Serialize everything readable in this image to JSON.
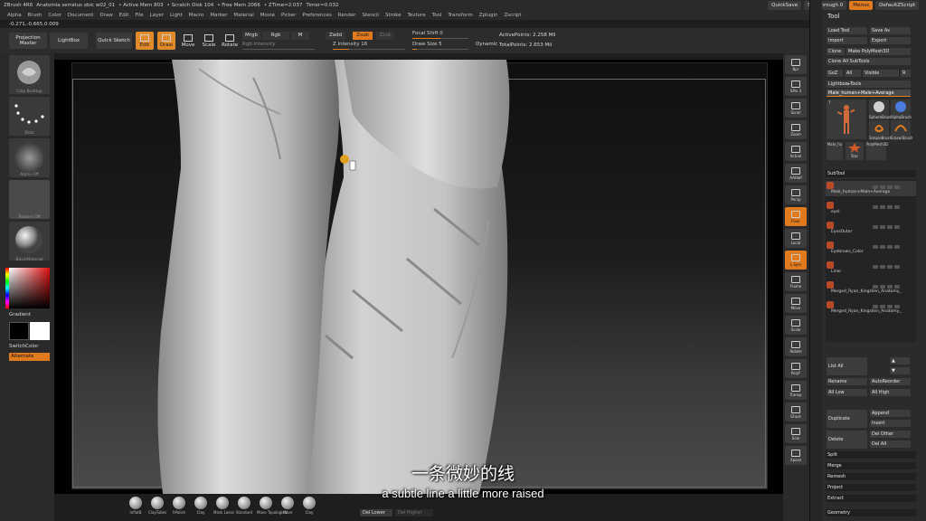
{
  "title_bar": {
    "items": [
      "ZBrush 4R6",
      "Anatomia serratus obic w02_01",
      "• Active Mem 803",
      "• Scratch Disk 104",
      "• Free Mem 2066",
      "• ZTime≈2.037",
      "Timer≈0.032"
    ],
    "right_buttons": [
      "QuickSave",
      "See-through 0",
      "Menus",
      "DefaultZScript"
    ]
  },
  "menu_bar": [
    "Alpha",
    "Brush",
    "Color",
    "Document",
    "Draw",
    "Edit",
    "File",
    "Layer",
    "Light",
    "Macro",
    "Marker",
    "Material",
    "Movie",
    "Picker",
    "Preferences",
    "Render",
    "Stencil",
    "Stroke",
    "Texture",
    "Tool",
    "Transform",
    "Zplugin",
    "Zscript"
  ],
  "coordinates": "-0.271,-0.665,0.009",
  "toolbar": {
    "projection_master": "Projection Master",
    "lightbox": "LightBox",
    "quick_sketch": "Quick Sketch",
    "edit": "Edit",
    "draw": "Draw",
    "move": "Move",
    "scale": "Scale",
    "rotate": "Rotate",
    "mrgb": "Mrgb",
    "rgb": "Rgb",
    "m": "M",
    "zadd": "Zadd",
    "zsub": "Zsub",
    "zcut": "Zcut",
    "rgb_intensity": "Rgb Intensity",
    "z_intensity": "Z Intensity 16",
    "focal_shift": "Focal Shift 0",
    "draw_size": "Draw Size 5",
    "dynamic": "Dynamic",
    "active_points": "ActivePoints: 2.258 Mil",
    "total_points": "TotalPoints: 2.653 Mil"
  },
  "left_panel": {
    "tiles": [
      "Clay Buildup",
      "Dots",
      "Alpha Off",
      "Texture Off",
      "BasicMaterial"
    ],
    "gradient": "Gradient",
    "switch_color": "SwitchColor",
    "alternate": "Alternate"
  },
  "right_tools": [
    "Bpr",
    "SPix 3",
    "Scroll",
    "Zoom",
    "Actual",
    "AAHalf",
    "Persp",
    "Floor",
    "Local",
    "L.Sym",
    "Frame",
    "Move",
    "Scale",
    "Rotate",
    "PolyF",
    "Transp",
    "Ghost",
    "Solo",
    "Xpose"
  ],
  "tool_panel": {
    "header": "Tool",
    "buttons": {
      "load_tool": "Load Tool",
      "save_as": "Save As",
      "import": "Import",
      "export": "Export",
      "clone": "Clone",
      "make_polymesh": "Make PolyMesh3D",
      "clone_all": "Clone All SubTools",
      "goz": "GoZ",
      "all": "All",
      "visible": "Visible",
      "r": "R",
      "lightbox_tools": "Lightbox▸Tools",
      "current_tool": "Male_human+Male+Average",
      "current_tool_count": "7"
    },
    "thumbs": [
      "Male_human",
      "SphereBrush",
      "AlphaBrush",
      "SimpleBrush",
      "EraserBrush",
      "Star",
      "PolyMesh3D",
      "Male_hu"
    ],
    "subtool_header": "SubTool",
    "subtools": [
      "Male_human+Male+Average",
      "eyel",
      "EyesOuter",
      "Eyebrows_Color",
      "Liner",
      "Merged_Ryan_Kingslien_Anatomy_",
      "Merged_Ryan_Kingslien_Anatomy_"
    ],
    "list_all": "List All",
    "rename": "Rename",
    "autoreorder": "AutoReorder",
    "all_low": "All Low",
    "all_high": "All High",
    "duplicate": "Duplicate",
    "append": "Append",
    "insert": "Insert",
    "delete": "Delete",
    "del_other": "Del Other",
    "del_all": "Del All",
    "split": "Split",
    "merge": "Merge",
    "remesh": "Remesh",
    "project": "Project",
    "extract": "Extract",
    "geometry": "Geometry"
  },
  "brushes": [
    "InflatB",
    "ClayTubes",
    "hPolish",
    "Clay",
    "Mask Lasso",
    "Standard",
    "Move Topological",
    "Move",
    "Clay"
  ],
  "bottom_buttons": {
    "del_lower": "Del Lower",
    "del_higher": "Del Higher"
  },
  "subtitle_cn": "一条微妙的线",
  "subtitle_en": "a subtle line a little more raised",
  "colors": {
    "accent": "#e07a1f",
    "panel": "#2b2b2b",
    "canvas": "#000000"
  }
}
